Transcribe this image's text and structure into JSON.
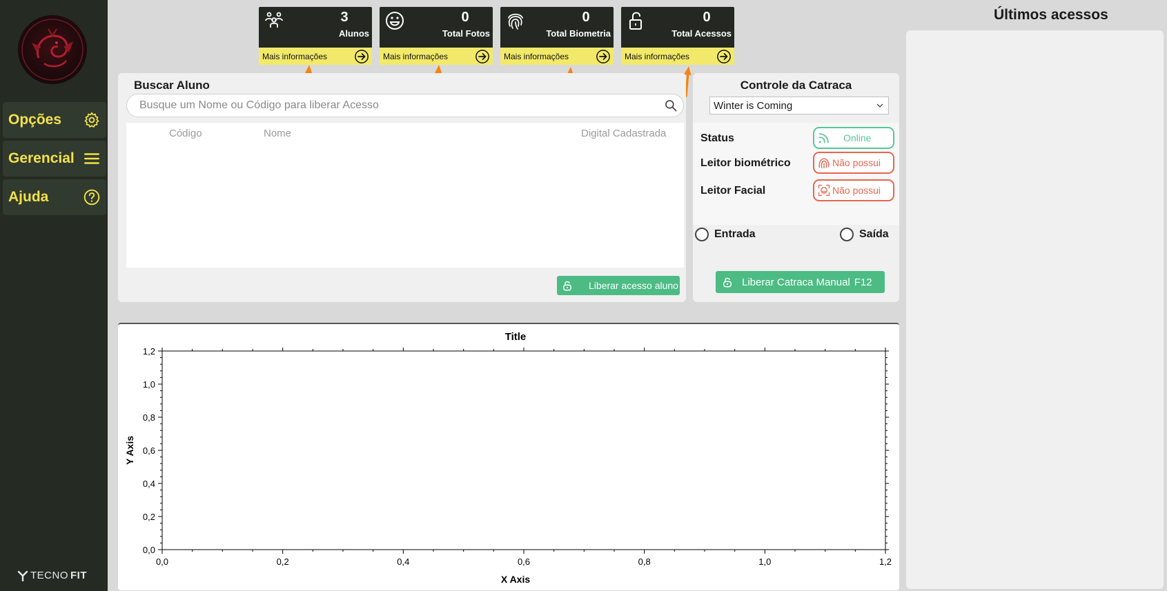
{
  "sidebar": {
    "menu": [
      {
        "label": "Opções",
        "icon": "gear-icon"
      },
      {
        "label": "Gerencial",
        "icon": "hamburger-icon"
      },
      {
        "label": "Ajuda",
        "icon": "help-circle-icon"
      }
    ],
    "brand_prefix": "TECNO",
    "brand_suffix": "FIT"
  },
  "cards": [
    {
      "value": "3",
      "label": "Alunos",
      "more": "Mais informações",
      "icon": "users-icon"
    },
    {
      "value": "0",
      "label": "Total Fotos",
      "more": "Mais informações",
      "icon": "smile-icon"
    },
    {
      "value": "0",
      "label": "Total Biometria",
      "more": "Mais informações",
      "icon": "fingerprint-icon"
    },
    {
      "value": "0",
      "label": "Total Acessos",
      "more": "Mais informações",
      "icon": "unlock-icon"
    }
  ],
  "search": {
    "title": "Buscar Aluno",
    "placeholder": "Busque um Nome ou Código para liberar Acesso",
    "columns": [
      "Código",
      "Nome",
      "Digital Cadastrada"
    ],
    "release_button": "Liberar acesso aluno"
  },
  "catraca": {
    "title": "Controle da Catraca",
    "selected": "Winter is Coming",
    "status_label": "Status",
    "status_value": "Online",
    "bio_label": "Leitor biométrico",
    "bio_value": "Não possui",
    "facial_label": "Leitor Facial",
    "facial_value": "Não possui",
    "entrada": "Entrada",
    "saida": "Saída",
    "manual_button": "Liberar Catraca Manual",
    "manual_shortcut": "F12"
  },
  "right": {
    "title": "Últimos acessos"
  },
  "colors": {
    "accent_yellow": "#f2e14b",
    "sidebar": "#252a22",
    "green": "#4cbb84",
    "red": "#e9644f"
  },
  "chart_data": {
    "type": "scatter",
    "title": "Title",
    "xlabel": "X Axis",
    "ylabel": "Y Axis",
    "xlim": [
      0,
      1.2
    ],
    "ylim": [
      0,
      1.2
    ],
    "xticks": [
      "0,0",
      "0,2",
      "0,4",
      "0,6",
      "0,8",
      "1,0",
      "1,2"
    ],
    "yticks": [
      "0,0",
      "0,2",
      "0,4",
      "0,6",
      "0,8",
      "1,0",
      "1,2"
    ],
    "series": []
  }
}
